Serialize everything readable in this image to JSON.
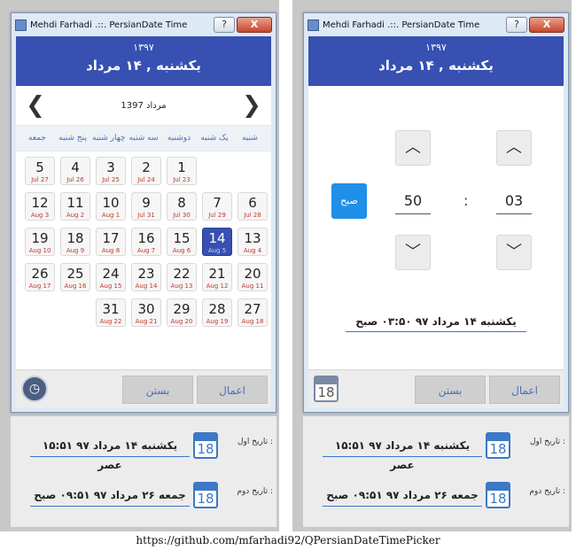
{
  "window": {
    "title": "Mehdi Farhadi .::. PersianDate Time",
    "help_glyph": "?",
    "close_glyph": "X"
  },
  "header": {
    "year": "۱۳۹۷",
    "date": "یکشنبه , ۱۴ مرداد"
  },
  "calendar": {
    "prev_glyph": "❮",
    "next_glyph": "❯",
    "month_label": "مرداد 1397",
    "weekdays": [
      "جمعه",
      "پنج شنبه",
      "چهار شنبه",
      "سه شنبه",
      "دوشنبه",
      "یک شنبه",
      "شنبه"
    ],
    "rows": [
      [
        {
          "p": "5",
          "g": "Jul 27"
        },
        {
          "p": "4",
          "g": "Jul 26"
        },
        {
          "p": "3",
          "g": "Jul 25"
        },
        {
          "p": "2",
          "g": "Jul 24"
        },
        {
          "p": "1",
          "g": "Jul 23"
        }
      ],
      [
        {
          "p": "12",
          "g": "Aug 3"
        },
        {
          "p": "11",
          "g": "Aug 2"
        },
        {
          "p": "10",
          "g": "Aug 1"
        },
        {
          "p": "9",
          "g": "Jul 31"
        },
        {
          "p": "8",
          "g": "Jul 30"
        },
        {
          "p": "7",
          "g": "Jul 29"
        },
        {
          "p": "6",
          "g": "Jul 28"
        }
      ],
      [
        {
          "p": "19",
          "g": "Aug 10"
        },
        {
          "p": "18",
          "g": "Aug 9"
        },
        {
          "p": "17",
          "g": "Aug 8"
        },
        {
          "p": "16",
          "g": "Aug 7"
        },
        {
          "p": "15",
          "g": "Aug 6"
        },
        {
          "p": "14",
          "g": "Aug 5",
          "selected": true
        },
        {
          "p": "13",
          "g": "Aug 4"
        }
      ],
      [
        {
          "p": "26",
          "g": "Aug 17"
        },
        {
          "p": "25",
          "g": "Aug 16"
        },
        {
          "p": "24",
          "g": "Aug 15"
        },
        {
          "p": "23",
          "g": "Aug 14"
        },
        {
          "p": "22",
          "g": "Aug 13"
        },
        {
          "p": "21",
          "g": "Aug 12"
        },
        {
          "p": "20",
          "g": "Aug 11"
        }
      ],
      [
        null,
        null,
        {
          "p": "31",
          "g": "Aug 22"
        },
        {
          "p": "30",
          "g": "Aug 21"
        },
        {
          "p": "29",
          "g": "Aug 20"
        },
        {
          "p": "28",
          "g": "Aug 19"
        },
        {
          "p": "27",
          "g": "Aug 18"
        }
      ]
    ]
  },
  "time": {
    "up_glyph": "︿",
    "down_glyph": "﹀",
    "ampm": "صبح",
    "minute": "50",
    "hour": "03",
    "colon": ":",
    "summary": "یکشنبه ۱۴ مرداد ۹۷ ۰۳:۵۰ صبح"
  },
  "buttons": {
    "apply": "اعمال",
    "close": "بستن"
  },
  "icons": {
    "calendar_day": "18",
    "clock_glyph": "◷"
  },
  "fields": [
    {
      "label": "تاریخ اول :",
      "value": "یکشنبه ۱۴ مرداد ۹۷ ۱۵:۵۱ عصر"
    },
    {
      "label": "تاریخ دوم :",
      "value": "جمعه ۲۶ مرداد ۹۷ ۰۹:۵۱ صبح"
    }
  ],
  "footer_url": "https://github.com/mfarhadi92/QPersianDateTimePicker"
}
